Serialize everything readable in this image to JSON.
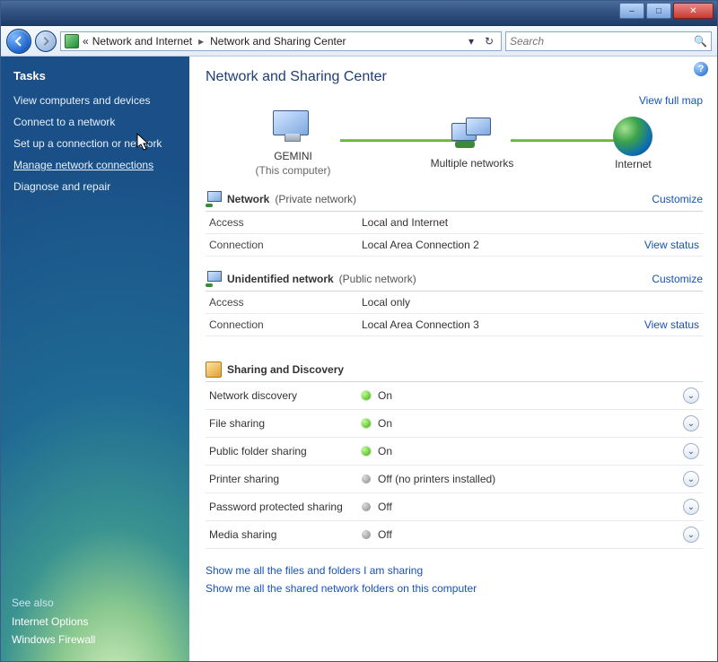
{
  "titlebar": {
    "minimize": "–",
    "maximize": "□",
    "close": "✕"
  },
  "nav": {
    "crumb_prefix": "«",
    "crumb1": "Network and Internet",
    "crumb2": "Network and Sharing Center",
    "search_placeholder": "Search"
  },
  "sidebar": {
    "tasks_title": "Tasks",
    "items": [
      "View computers and devices",
      "Connect to a network",
      "Set up a connection or network",
      "Manage network connections",
      "Diagnose and repair"
    ],
    "see_also_title": "See also",
    "see_also": [
      "Internet Options",
      "Windows Firewall"
    ]
  },
  "content": {
    "page_title": "Network and Sharing Center",
    "view_full_map": "View full map",
    "map": {
      "node1": "GEMINI",
      "node1_sub": "(This computer)",
      "node2": "Multiple networks",
      "node3": "Internet"
    },
    "net1": {
      "name": "Network",
      "type": "(Private network)",
      "customize": "Customize",
      "access_label": "Access",
      "access_value": "Local and Internet",
      "conn_label": "Connection",
      "conn_value": "Local Area Connection 2",
      "view_status": "View status"
    },
    "net2": {
      "name": "Unidentified network",
      "type": "(Public network)",
      "customize": "Customize",
      "access_label": "Access",
      "access_value": "Local only",
      "conn_label": "Connection",
      "conn_value": "Local Area Connection 3",
      "view_status": "View status"
    },
    "sharing_title": "Sharing and Discovery",
    "sd": [
      {
        "label": "Network discovery",
        "value": "On",
        "on": true
      },
      {
        "label": "File sharing",
        "value": "On",
        "on": true
      },
      {
        "label": "Public folder sharing",
        "value": "On",
        "on": true
      },
      {
        "label": "Printer sharing",
        "value": "Off (no printers installed)",
        "on": false
      },
      {
        "label": "Password protected sharing",
        "value": "Off",
        "on": false
      },
      {
        "label": "Media sharing",
        "value": "Off",
        "on": false
      }
    ],
    "link1": "Show me all the files and folders I am sharing",
    "link2": "Show me all the shared network folders on this computer"
  }
}
